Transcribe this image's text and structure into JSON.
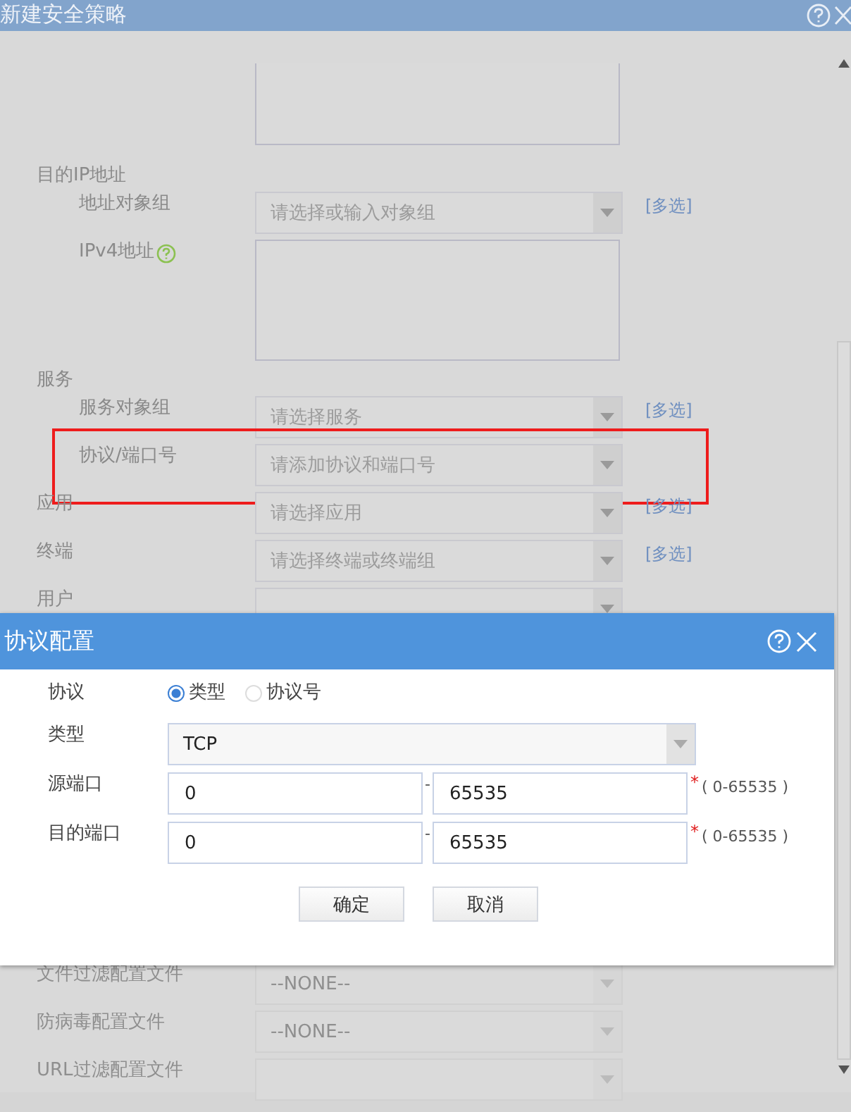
{
  "window": {
    "title": "新建安全策略"
  },
  "fields": [
    {
      "kind": "area"
    },
    {
      "kind": "heading",
      "label": "目的IP地址",
      "children": [
        {
          "kind": "select",
          "label": "地址对象组",
          "placeholder": "请选择或输入对象组",
          "link": "[多选]"
        },
        {
          "kind": "area",
          "label": "IPv4地址",
          "help": true
        }
      ]
    },
    {
      "kind": "heading",
      "label": "服务",
      "children": [
        {
          "kind": "select",
          "label": "服务对象组",
          "placeholder": "请选择服务",
          "link": "[多选]"
        },
        {
          "kind": "select",
          "label": "协议/端口号",
          "placeholder": "请添加协议和端口号",
          "highlighted": true
        }
      ]
    },
    {
      "kind": "select",
      "label": "应用",
      "placeholder": "请选择应用",
      "link": "[多选]"
    },
    {
      "kind": "select",
      "label": "终端",
      "placeholder": "请选择终端或终端组",
      "link": "[多选]"
    },
    {
      "kind": "select",
      "label": "用户"
    }
  ],
  "lower_fields": [
    {
      "kind": "select",
      "label": "文件过滤配置文件",
      "value": "--NONE--"
    },
    {
      "kind": "select",
      "label": "防病毒配置文件",
      "value": "--NONE--"
    },
    {
      "kind": "select",
      "label": "URL过滤配置文件"
    }
  ],
  "dialog": {
    "title": "协议配置",
    "rows": [
      {
        "kind": "radio",
        "label": "协议",
        "options": [
          {
            "label": "类型",
            "selected": true
          },
          {
            "label": "协议号",
            "selected": false
          }
        ]
      },
      {
        "kind": "select",
        "label": "类型",
        "value": "TCP"
      },
      {
        "kind": "range",
        "label": "源端口",
        "from": "0",
        "separator": "-",
        "to": "65535",
        "required": "*",
        "hint": "( 0-65535 )"
      },
      {
        "kind": "range",
        "label": "目的端口",
        "from": "0",
        "separator": "-",
        "to": "65535",
        "required": "*",
        "hint": "( 0-65535 )"
      }
    ],
    "buttons": [
      "确定",
      "取消"
    ]
  }
}
